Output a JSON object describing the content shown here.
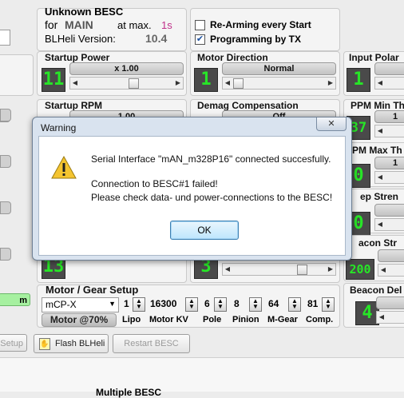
{
  "esc_info": {
    "name": "Unknown BESC",
    "for_label": "for",
    "target": "MAIN",
    "at_max_label": "at max.",
    "at_max_value": "1s",
    "version_label": "BLHeli Version:",
    "version_value": "10.4"
  },
  "options": [
    {
      "label": "Re-Arming every Start",
      "checked": false
    },
    {
      "label": "Programming by TX",
      "checked": true
    }
  ],
  "settings": {
    "startup_power": {
      "title": "Startup Power",
      "lcd": "11",
      "value": "x 1.00"
    },
    "motor_direction": {
      "title": "Motor Direction",
      "lcd": "1",
      "value": "Normal"
    },
    "input_polarity": {
      "title": "Input Polar",
      "lcd": "1",
      "value": ""
    },
    "startup_rpm": {
      "title": "Startup RPM",
      "value": "1.00"
    },
    "demag_compensation": {
      "title": "Demag Compensation",
      "value": "Off"
    },
    "ppm_min": {
      "title": "PPM Min Th",
      "lcd": "37",
      "value": "1"
    },
    "ppm_max": {
      "title": "PM Max Th",
      "lcd": "0",
      "value": "1"
    },
    "beep_strength": {
      "title": "ep Stren",
      "lcd": "0"
    },
    "beacon_strength": {
      "title": "acon Str",
      "lcd": "200"
    },
    "left_col_lcd": "13",
    "mid_col_lcd": "3",
    "beacon_delay": {
      "title": "Beacon Del",
      "lcd": "4"
    },
    "left_edge_label": "m"
  },
  "gear_setup": {
    "title": "Motor / Gear Setup",
    "model": "mCP-X",
    "mode_button": "Motor @70%",
    "fields": [
      {
        "value": "1",
        "label": "Lipo"
      },
      {
        "value": "16300",
        "label": "Motor KV"
      },
      {
        "value": "6",
        "label": "Pole"
      },
      {
        "value": "8",
        "label": "Pinion"
      },
      {
        "value": "64",
        "label": "M-Gear"
      },
      {
        "value": "81",
        "label": "Comp."
      }
    ]
  },
  "toolbar": {
    "setup_label": "Setup",
    "flash_label": "Flash BLHeli",
    "restart_label": "Restart BESC"
  },
  "bottom": {
    "label": "Multiple BESC"
  },
  "dialog": {
    "title": "Warning",
    "line1": "Serial Interface \"mAN_m328P16\" connected succesfully.",
    "line2": "Connection to BESC#1 failed!",
    "line3": "Please check data- und power-connections to the BESC!",
    "ok_label": "OK",
    "close_label": "✕"
  }
}
